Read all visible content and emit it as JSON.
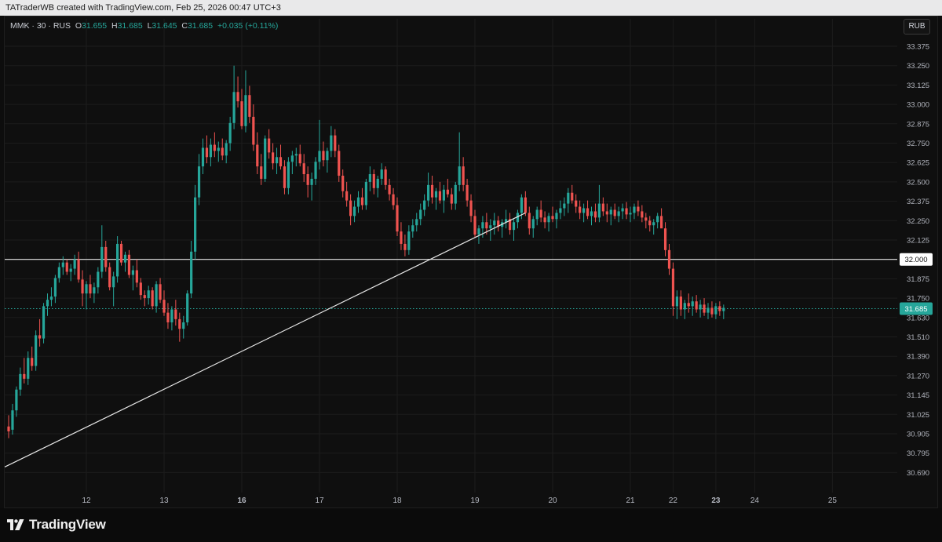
{
  "header": {
    "attribution": "TATraderWB created with TradingView.com, Feb 25, 2026 00:47 UTC+3"
  },
  "legend": {
    "symbol": "MMK · 30 · RUS",
    "open_label": "O",
    "open": "31.655",
    "high_label": "H",
    "high": "31.685",
    "low_label": "L",
    "low": "31.645",
    "close_label": "C",
    "close": "31.685",
    "change": "+0.035 (+0.11%)"
  },
  "currency_button": "RUB",
  "footer": {
    "brand": "TradingView",
    "logo_icon": "tradingview-logo-icon"
  },
  "colors": {
    "up": "#26a69a",
    "down": "#ef5350",
    "background": "#0f0f0f",
    "grid": "#1c1c1c",
    "text": "#d1d4dc",
    "line": "#e6e6e6"
  },
  "chart_data": {
    "type": "candlestick",
    "symbol": "MMK",
    "interval": "30",
    "currency": "RUB",
    "grid": true,
    "y_ticks": [
      "33.375",
      "33.250",
      "33.125",
      "33.000",
      "32.875",
      "32.750",
      "32.625",
      "32.500",
      "32.375",
      "32.250",
      "32.125",
      "32.000",
      "31.875",
      "31.750",
      "31.630",
      "31.510",
      "31.390",
      "31.270",
      "31.145",
      "31.025",
      "30.905",
      "30.795",
      "30.690"
    ],
    "x_ticks": [
      {
        "label": "12",
        "idx": 20,
        "bold": false
      },
      {
        "label": "13",
        "idx": 40,
        "bold": false
      },
      {
        "label": "16",
        "idx": 60,
        "bold": true
      },
      {
        "label": "17",
        "idx": 80,
        "bold": false
      },
      {
        "label": "18",
        "idx": 100,
        "bold": false
      },
      {
        "label": "19",
        "idx": 120,
        "bold": false
      },
      {
        "label": "20",
        "idx": 140,
        "bold": false
      },
      {
        "label": "21",
        "idx": 160,
        "bold": false
      },
      {
        "label": "22",
        "idx": 171,
        "bold": false
      },
      {
        "label": "23",
        "idx": 182,
        "bold": true
      },
      {
        "label": "24",
        "idx": 192,
        "bold": false
      },
      {
        "label": "25",
        "idx": 212,
        "bold": false
      }
    ],
    "horizontal_line": {
      "value": 32.0,
      "label": "32.000"
    },
    "last_price": {
      "value": 31.685,
      "label": "31.685"
    },
    "trend_line": {
      "from": {
        "idx": -1,
        "price": 30.72
      },
      "to": {
        "idx": 133,
        "price": 32.3
      }
    },
    "candles": [
      [
        30.95,
        31.02,
        30.88,
        30.92
      ],
      [
        30.93,
        31.09,
        30.9,
        31.05
      ],
      [
        31.05,
        31.2,
        31.01,
        31.18
      ],
      [
        31.18,
        31.32,
        31.14,
        31.28
      ],
      [
        31.28,
        31.38,
        31.22,
        31.25
      ],
      [
        31.25,
        31.42,
        31.21,
        31.38
      ],
      [
        31.38,
        31.45,
        31.3,
        31.33
      ],
      [
        31.33,
        31.55,
        31.3,
        31.52
      ],
      [
        31.52,
        31.62,
        31.45,
        31.5
      ],
      [
        31.5,
        31.72,
        31.47,
        31.7
      ],
      [
        31.7,
        31.78,
        31.64,
        31.74
      ],
      [
        31.74,
        31.82,
        31.7,
        31.76
      ],
      [
        31.76,
        31.9,
        31.72,
        31.88
      ],
      [
        31.88,
        31.98,
        31.85,
        31.95
      ],
      [
        31.95,
        32.02,
        31.9,
        31.98
      ],
      [
        31.98,
        32.0,
        31.9,
        31.92
      ],
      [
        31.92,
        31.97,
        31.86,
        31.94
      ],
      [
        31.94,
        32.03,
        31.9,
        32.0
      ],
      [
        32.0,
        32.05,
        31.85,
        31.87
      ],
      [
        31.87,
        31.93,
        31.7,
        31.78
      ],
      [
        31.78,
        31.86,
        31.68,
        31.84
      ],
      [
        31.84,
        31.9,
        31.75,
        31.78
      ],
      [
        31.78,
        31.85,
        31.72,
        31.82
      ],
      [
        31.82,
        31.95,
        31.78,
        31.92
      ],
      [
        31.92,
        32.22,
        31.88,
        32.08
      ],
      [
        32.08,
        32.12,
        31.92,
        31.95
      ],
      [
        31.95,
        31.98,
        31.8,
        31.82
      ],
      [
        31.82,
        31.92,
        31.7,
        31.89
      ],
      [
        31.89,
        32.15,
        31.85,
        32.1
      ],
      [
        32.1,
        32.12,
        31.96,
        31.98
      ],
      [
        31.98,
        32.05,
        31.92,
        32.03
      ],
      [
        32.03,
        32.06,
        31.88,
        31.9
      ],
      [
        31.9,
        31.96,
        31.8,
        31.93
      ],
      [
        31.93,
        32.0,
        31.82,
        31.85
      ],
      [
        31.85,
        31.88,
        31.74,
        31.77
      ],
      [
        31.77,
        31.8,
        31.7,
        31.75
      ],
      [
        31.75,
        31.83,
        31.71,
        31.8
      ],
      [
        31.8,
        31.82,
        31.68,
        31.7
      ],
      [
        31.7,
        31.86,
        31.66,
        31.84
      ],
      [
        31.84,
        31.88,
        31.72,
        31.74
      ],
      [
        31.74,
        31.8,
        31.64,
        31.66
      ],
      [
        31.66,
        31.72,
        31.56,
        31.6
      ],
      [
        31.6,
        31.7,
        31.55,
        31.68
      ],
      [
        31.68,
        31.74,
        31.58,
        31.62
      ],
      [
        31.62,
        31.66,
        31.48,
        31.56
      ],
      [
        31.56,
        31.64,
        31.5,
        31.6
      ],
      [
        31.6,
        31.8,
        31.58,
        31.78
      ],
      [
        31.78,
        32.12,
        31.75,
        32.05
      ],
      [
        32.05,
        32.48,
        32.0,
        32.4
      ],
      [
        32.4,
        32.68,
        32.35,
        32.6
      ],
      [
        32.6,
        32.78,
        32.55,
        32.72
      ],
      [
        32.72,
        32.8,
        32.62,
        32.66
      ],
      [
        32.66,
        32.78,
        32.6,
        32.74
      ],
      [
        32.74,
        32.82,
        32.66,
        32.7
      ],
      [
        32.7,
        32.76,
        32.63,
        32.72
      ],
      [
        32.72,
        32.78,
        32.64,
        32.67
      ],
      [
        32.67,
        32.77,
        32.62,
        32.75
      ],
      [
        32.75,
        32.92,
        32.7,
        32.88
      ],
      [
        32.88,
        33.25,
        32.84,
        33.08
      ],
      [
        33.08,
        33.18,
        32.98,
        33.02
      ],
      [
        33.02,
        33.1,
        32.84,
        32.86
      ],
      [
        32.86,
        33.22,
        32.82,
        33.06
      ],
      [
        33.06,
        33.12,
        32.88,
        32.92
      ],
      [
        32.92,
        33.0,
        32.7,
        32.74
      ],
      [
        32.74,
        32.82,
        32.55,
        32.6
      ],
      [
        32.6,
        32.68,
        32.48,
        32.52
      ],
      [
        32.52,
        32.8,
        32.5,
        32.78
      ],
      [
        32.78,
        32.84,
        32.65,
        32.69
      ],
      [
        32.69,
        32.75,
        32.58,
        32.62
      ],
      [
        32.62,
        32.72,
        32.55,
        32.66
      ],
      [
        32.66,
        32.74,
        32.58,
        32.6
      ],
      [
        32.6,
        32.64,
        32.42,
        32.46
      ],
      [
        32.46,
        32.66,
        32.42,
        32.63
      ],
      [
        32.63,
        32.7,
        32.55,
        32.67
      ],
      [
        32.67,
        32.72,
        32.6,
        32.68
      ],
      [
        32.68,
        32.74,
        32.6,
        32.62
      ],
      [
        32.62,
        32.68,
        32.5,
        32.55
      ],
      [
        32.55,
        32.6,
        32.4,
        32.48
      ],
      [
        32.48,
        32.56,
        32.38,
        32.52
      ],
      [
        32.52,
        32.66,
        32.48,
        32.63
      ],
      [
        32.63,
        32.9,
        32.58,
        32.7
      ],
      [
        32.7,
        32.76,
        32.6,
        32.64
      ],
      [
        32.64,
        32.72,
        32.56,
        32.7
      ],
      [
        32.7,
        32.86,
        32.66,
        32.8
      ],
      [
        32.8,
        32.84,
        32.66,
        32.7
      ],
      [
        32.7,
        32.74,
        32.5,
        32.54
      ],
      [
        32.54,
        32.58,
        32.4,
        32.44
      ],
      [
        32.44,
        32.5,
        32.34,
        32.38
      ],
      [
        32.38,
        32.42,
        32.22,
        32.28
      ],
      [
        32.28,
        32.38,
        32.24,
        32.34
      ],
      [
        32.34,
        32.44,
        32.3,
        32.4
      ],
      [
        32.4,
        32.46,
        32.32,
        32.35
      ],
      [
        32.35,
        32.52,
        32.32,
        32.5
      ],
      [
        32.5,
        32.6,
        32.44,
        32.55
      ],
      [
        32.55,
        32.58,
        32.42,
        32.46
      ],
      [
        32.46,
        32.54,
        32.4,
        32.52
      ],
      [
        32.52,
        32.62,
        32.48,
        32.58
      ],
      [
        32.58,
        32.6,
        32.45,
        32.48
      ],
      [
        32.48,
        32.52,
        32.38,
        32.42
      ],
      [
        32.42,
        32.46,
        32.32,
        32.35
      ],
      [
        32.35,
        32.4,
        32.15,
        32.18
      ],
      [
        32.18,
        32.24,
        32.06,
        32.1
      ],
      [
        32.1,
        32.16,
        32.02,
        32.06
      ],
      [
        32.06,
        32.22,
        32.03,
        32.18
      ],
      [
        32.18,
        32.26,
        32.14,
        32.22
      ],
      [
        32.22,
        32.3,
        32.18,
        32.26
      ],
      [
        32.26,
        32.36,
        32.22,
        32.32
      ],
      [
        32.32,
        32.42,
        32.28,
        32.38
      ],
      [
        32.38,
        32.56,
        32.34,
        32.48
      ],
      [
        32.48,
        32.54,
        32.36,
        32.4
      ],
      [
        32.4,
        32.46,
        32.32,
        32.44
      ],
      [
        32.44,
        32.5,
        32.36,
        32.38
      ],
      [
        32.38,
        32.48,
        32.3,
        32.45
      ],
      [
        32.45,
        32.52,
        32.4,
        32.42
      ],
      [
        32.42,
        32.46,
        32.32,
        32.36
      ],
      [
        32.36,
        32.5,
        32.32,
        32.48
      ],
      [
        32.48,
        32.82,
        32.44,
        32.6
      ],
      [
        32.6,
        32.66,
        32.44,
        32.48
      ],
      [
        32.48,
        32.52,
        32.34,
        32.38
      ],
      [
        32.38,
        32.42,
        32.24,
        32.28
      ],
      [
        32.28,
        32.32,
        32.14,
        32.16
      ],
      [
        32.16,
        32.22,
        32.1,
        32.2
      ],
      [
        32.2,
        32.28,
        32.14,
        32.24
      ],
      [
        32.24,
        32.3,
        32.16,
        32.2
      ],
      [
        32.2,
        32.26,
        32.12,
        32.22
      ],
      [
        32.22,
        32.3,
        32.16,
        32.25
      ],
      [
        32.25,
        32.28,
        32.18,
        32.21
      ],
      [
        32.21,
        32.26,
        32.14,
        32.24
      ],
      [
        32.24,
        32.32,
        32.2,
        32.26
      ],
      [
        32.26,
        32.3,
        32.16,
        32.19
      ],
      [
        32.19,
        32.26,
        32.12,
        32.24
      ],
      [
        32.24,
        32.32,
        32.2,
        32.3
      ],
      [
        32.3,
        32.42,
        32.26,
        32.4
      ],
      [
        32.4,
        32.44,
        32.28,
        32.3
      ],
      [
        32.3,
        32.34,
        32.16,
        32.2
      ],
      [
        32.2,
        32.28,
        32.14,
        32.26
      ],
      [
        32.26,
        32.34,
        32.22,
        32.32
      ],
      [
        32.32,
        32.38,
        32.24,
        32.27
      ],
      [
        32.27,
        32.31,
        32.2,
        32.24
      ],
      [
        32.24,
        32.3,
        32.18,
        32.28
      ],
      [
        32.28,
        32.34,
        32.24,
        32.26
      ],
      [
        32.26,
        32.32,
        32.2,
        32.3
      ],
      [
        32.3,
        32.38,
        32.26,
        32.33
      ],
      [
        32.33,
        32.4,
        32.28,
        32.36
      ],
      [
        32.36,
        32.46,
        32.3,
        32.43
      ],
      [
        32.43,
        32.48,
        32.36,
        32.38
      ],
      [
        32.38,
        32.42,
        32.3,
        32.34
      ],
      [
        32.34,
        32.38,
        32.26,
        32.3
      ],
      [
        32.3,
        32.36,
        32.24,
        32.33
      ],
      [
        32.33,
        32.38,
        32.26,
        32.28
      ],
      [
        32.28,
        32.34,
        32.22,
        32.31
      ],
      [
        32.31,
        32.36,
        32.24,
        32.27
      ],
      [
        32.27,
        32.48,
        32.24,
        32.36
      ],
      [
        32.36,
        32.4,
        32.28,
        32.31
      ],
      [
        32.31,
        32.36,
        32.24,
        32.29
      ],
      [
        32.29,
        32.34,
        32.22,
        32.32
      ],
      [
        32.32,
        32.36,
        32.26,
        32.28
      ],
      [
        32.28,
        32.34,
        32.24,
        32.31
      ],
      [
        32.31,
        32.36,
        32.26,
        32.33
      ],
      [
        32.33,
        32.37,
        32.26,
        32.29
      ],
      [
        32.29,
        32.34,
        32.24,
        32.3
      ],
      [
        32.3,
        32.36,
        32.26,
        32.34
      ],
      [
        32.34,
        32.38,
        32.28,
        32.31
      ],
      [
        32.31,
        32.35,
        32.24,
        32.27
      ],
      [
        32.27,
        32.3,
        32.2,
        32.25
      ],
      [
        32.25,
        32.28,
        32.18,
        32.22
      ],
      [
        32.22,
        32.26,
        32.16,
        32.24
      ],
      [
        32.24,
        32.3,
        32.2,
        32.28
      ],
      [
        32.28,
        32.33,
        32.22,
        32.2
      ],
      [
        32.2,
        32.24,
        32.02,
        32.06
      ],
      [
        32.06,
        32.1,
        31.9,
        31.94
      ],
      [
        31.94,
        31.98,
        31.64,
        31.7
      ],
      [
        31.7,
        31.8,
        31.62,
        31.76
      ],
      [
        31.76,
        31.8,
        31.64,
        31.68
      ],
      [
        31.68,
        31.74,
        31.62,
        31.72
      ],
      [
        31.72,
        31.78,
        31.66,
        31.7
      ],
      [
        31.7,
        31.76,
        31.64,
        31.73
      ],
      [
        31.73,
        31.77,
        31.66,
        31.68
      ],
      [
        31.68,
        31.74,
        31.63,
        31.71
      ],
      [
        31.71,
        31.75,
        31.64,
        31.66
      ],
      [
        31.66,
        31.72,
        31.62,
        31.69
      ],
      [
        31.69,
        31.73,
        31.63,
        31.65
      ],
      [
        31.65,
        31.72,
        31.62,
        31.7
      ],
      [
        31.7,
        31.73,
        31.64,
        31.67
      ],
      [
        31.67,
        31.71,
        31.62,
        31.69
      ]
    ]
  }
}
